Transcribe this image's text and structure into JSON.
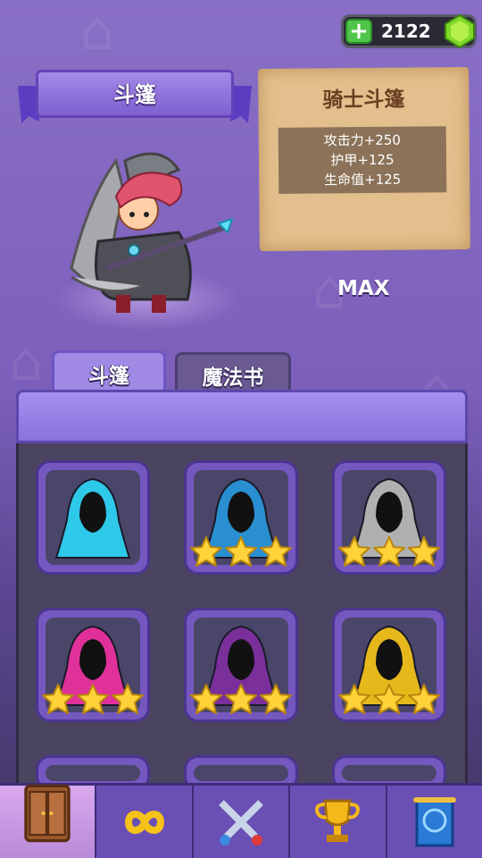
{
  "currency": {
    "amount": "2122",
    "add_icon": "plus-icon",
    "gem_icon": "green-gem-icon"
  },
  "banner": {
    "title": "斗篷"
  },
  "item_detail": {
    "name": "骑士斗篷",
    "stats": [
      "攻击力+250",
      "护甲+125",
      "生命值+125"
    ],
    "level_label": "MAX"
  },
  "tabs": [
    {
      "label": "斗篷",
      "active": true
    },
    {
      "label": "魔法书",
      "active": false
    }
  ],
  "cloaks": [
    {
      "color": "#2ec8e8",
      "stars": 0
    },
    {
      "color": "#2a8fd0",
      "stars": 3
    },
    {
      "color": "#b0b0b0",
      "stars": 3
    },
    {
      "color": "#e0309a",
      "stars": 3
    },
    {
      "color": "#7a2f9a",
      "stars": 3
    },
    {
      "color": "#e6b81c",
      "stars": 3
    }
  ],
  "nav": [
    {
      "icon": "wardrobe-icon",
      "active": true
    },
    {
      "icon": "infinity-icon",
      "active": false
    },
    {
      "icon": "crossed-swords-icon",
      "active": false
    },
    {
      "icon": "trophy-icon",
      "active": false
    },
    {
      "icon": "scroll-banner-icon",
      "active": false
    }
  ]
}
